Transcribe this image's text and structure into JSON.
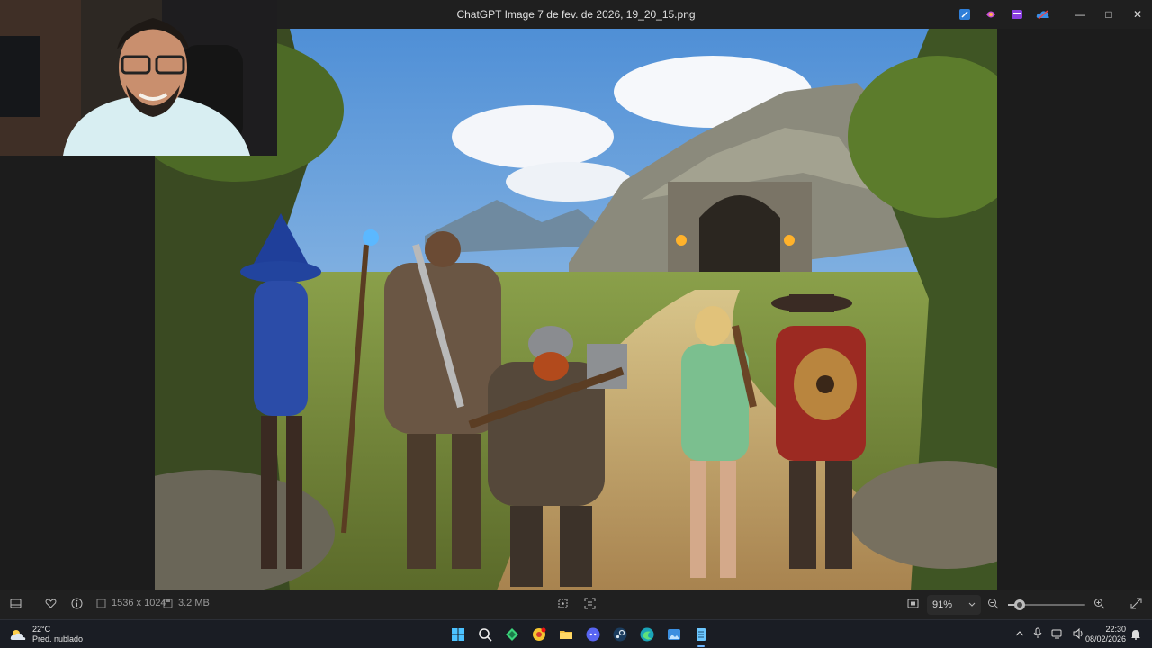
{
  "window": {
    "title": "ChatGPT Image 7 de fev. de 2026, 19_20_15.png",
    "title_icons": [
      "edit-icon",
      "copilot-icon",
      "clipchamp-icon",
      "onedrive-icon"
    ],
    "controls": {
      "minimize": "—",
      "maximize": "□",
      "close": "✕"
    }
  },
  "toolbar": {
    "dimensions": "1536 x 1024",
    "filesize": "3.2 MB",
    "zoom_value": "91%",
    "zoom_level": 0.15
  },
  "taskbar": {
    "weather_temp": "22°C",
    "weather_desc": "Pred. nublado",
    "apps": [
      "windows-start",
      "search",
      "xbox",
      "chrome-alt",
      "file-explorer",
      "discord",
      "steam",
      "edge",
      "photos",
      "notepad"
    ],
    "time": "22:30",
    "date": "08/02/2026"
  },
  "colors": {
    "accent": "#6fb6ff",
    "background": "#1c1c1c",
    "taskbar": "#1a1d24"
  }
}
